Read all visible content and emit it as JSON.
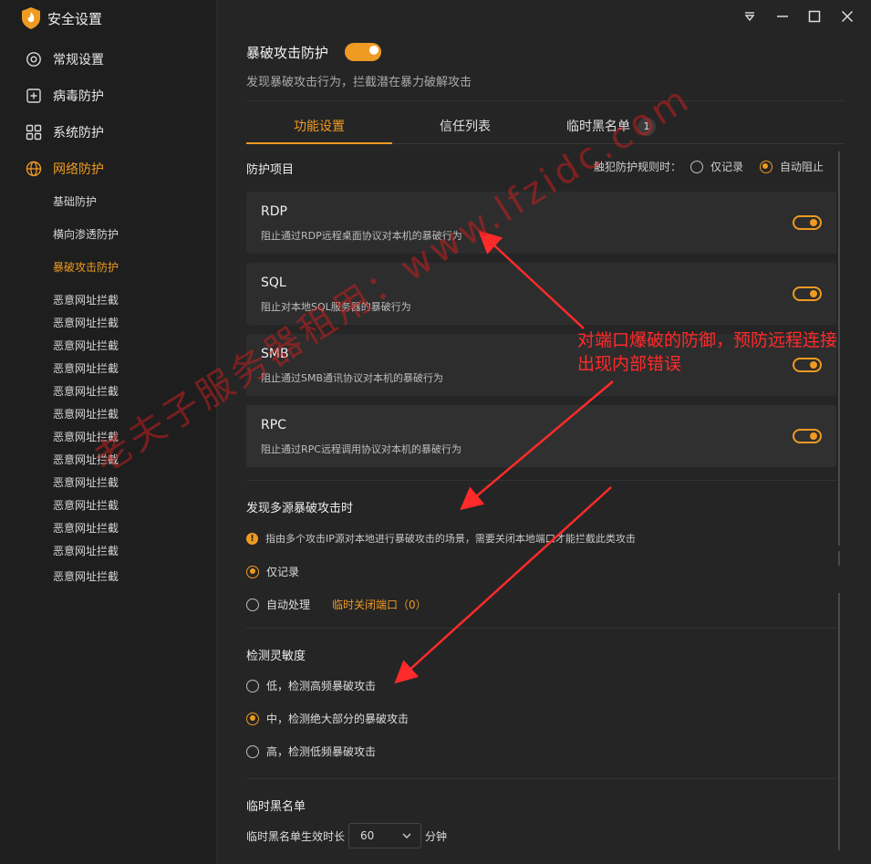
{
  "app": {
    "title": "安全设置"
  },
  "sidebar": {
    "items": [
      {
        "label": "常规设置",
        "icon": "gear-icon"
      },
      {
        "label": "病毒防护",
        "icon": "plus-box-icon"
      },
      {
        "label": "系统防护",
        "icon": "grid-icon"
      },
      {
        "label": "网络防护",
        "icon": "globe-icon",
        "active": true
      }
    ],
    "subitems": [
      {
        "label": "基础防护"
      },
      {
        "label": "横向渗透防护"
      },
      {
        "label": "暴破攻击防护",
        "active": true
      },
      {
        "label": "恶意网址拦截"
      },
      {
        "label": "恶意网址拦截"
      },
      {
        "label": "恶意网址拦截"
      },
      {
        "label": "恶意网址拦截"
      },
      {
        "label": "恶意网址拦截"
      },
      {
        "label": "恶意网址拦截"
      },
      {
        "label": "恶意网址拦截"
      },
      {
        "label": "恶意网址拦截"
      },
      {
        "label": "恶意网址拦截"
      },
      {
        "label": "恶意网址拦截"
      },
      {
        "label": "恶意网址拦截"
      },
      {
        "label": "恶意网址拦截"
      },
      {
        "label": "恶意网址拦截"
      }
    ]
  },
  "window_controls": [
    "menu-icon",
    "minimize-icon",
    "maximize-icon",
    "close-icon"
  ],
  "main": {
    "title": "暴破攻击防护",
    "enabled": true,
    "description": "发现暴破攻击行为，拦截潜在暴力破解攻击",
    "tabs": [
      {
        "label": "功能设置",
        "active": true
      },
      {
        "label": "信任列表"
      },
      {
        "label": "临时黑名单",
        "badge": "1"
      }
    ],
    "protection": {
      "heading": "防护项目",
      "policy_label": "触犯防护规则时：",
      "policy_options": [
        {
          "label": "仅记录",
          "checked": false
        },
        {
          "label": "自动阻止",
          "checked": true
        }
      ],
      "items": [
        {
          "name": "RDP",
          "desc": "阻止通过RDP远程桌面协议对本机的暴破行为",
          "enabled": true
        },
        {
          "name": "SQL",
          "desc": "阻止对本地SQL服务器的暴破行为",
          "enabled": true
        },
        {
          "name": "SMB",
          "desc": "阻止通过SMB通讯协议对本机的暴破行为",
          "enabled": true
        },
        {
          "name": "RPC",
          "desc": "阻止通过RPC远程调用协议对本机的暴破行为",
          "enabled": true
        }
      ]
    },
    "multi_source": {
      "heading": "发现多源暴破攻击时",
      "info": "指由多个攻击IP源对本地进行暴破攻击的场景，需要关闭本地端口才能拦截此类攻击",
      "options": [
        {
          "label": "仅记录",
          "checked": true
        },
        {
          "label": "自动处理",
          "checked": false,
          "link": "临时关闭端口（0）"
        }
      ]
    },
    "sensitivity": {
      "heading": "检测灵敏度",
      "options": [
        {
          "label": "低，检测高频暴破攻击",
          "checked": false
        },
        {
          "label": "中，检测绝大部分的暴破攻击",
          "checked": true
        },
        {
          "label": "高，检测低频暴破攻击",
          "checked": false
        }
      ]
    },
    "blacklist": {
      "heading": "临时黑名单",
      "duration_label": "临时黑名单生效时长",
      "duration_value": "60",
      "unit": "分钟"
    }
  },
  "overlay": {
    "watermark": "老夫子服务器租用：www.lfzidc.com",
    "annotation_line1": "对端口爆破的防御，预防远程连接",
    "annotation_line2": "出现内部错误",
    "arrow_color": "#ff2a2a",
    "watermark_color": "#d21e1e"
  },
  "colors": {
    "accent": "#ef9a22",
    "sidebar_bg": "#1e1e1e",
    "main_bg": "#252525",
    "card_bg": "#2d2d2d"
  }
}
